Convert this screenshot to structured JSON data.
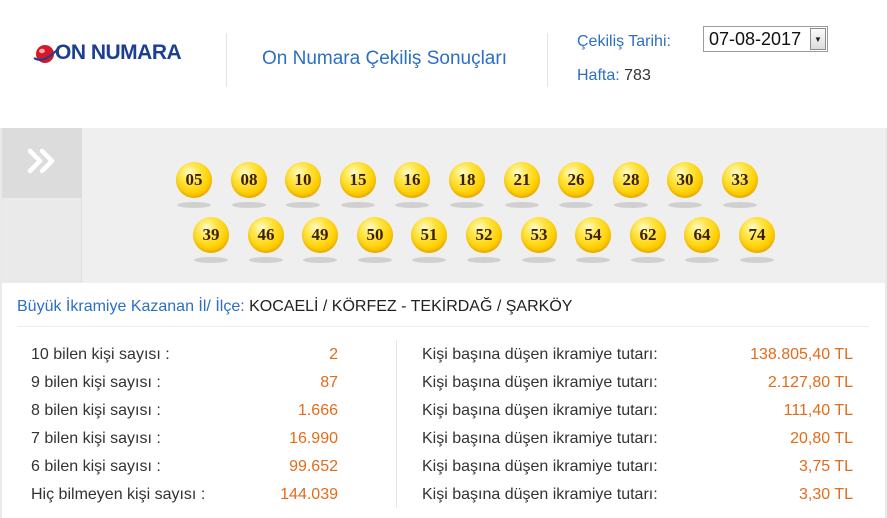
{
  "header": {
    "logo_text": "ON NUMARA",
    "title": "On Numara Çekiliş Sonuçları",
    "date_label": "Çekiliş Tarihi:",
    "date_value": "07-08-2017",
    "week_label": "Hafta:",
    "week_value": "783"
  },
  "nav": {
    "icon": "double-chevron-right-icon"
  },
  "balls": {
    "row1": [
      "05",
      "08",
      "10",
      "15",
      "16",
      "18",
      "21",
      "26",
      "28",
      "30",
      "33"
    ],
    "row2": [
      "39",
      "46",
      "49",
      "50",
      "51",
      "52",
      "53",
      "54",
      "62",
      "64",
      "74"
    ]
  },
  "location": {
    "label": "Büyük İkramiye Kazanan İl/ İlçe:",
    "value": "KOCAELİ / KÖRFEZ - TEKİRDAĞ / ŞARKÖY"
  },
  "results": [
    {
      "label": "10 bilen kişi sayısı :",
      "count": "2",
      "prize_label": "Kişi başına düşen ikramiye tutarı:",
      "amount": "138.805,40 TL"
    },
    {
      "label": "9 bilen kişi sayısı :",
      "count": "87",
      "prize_label": "Kişi başına düşen ikramiye tutarı:",
      "amount": "2.127,80 TL"
    },
    {
      "label": "8 bilen kişi sayısı :",
      "count": "1.666",
      "prize_label": "Kişi başına düşen ikramiye tutarı:",
      "amount": "111,40 TL"
    },
    {
      "label": "7 bilen kişi sayısı :",
      "count": "16.990",
      "prize_label": "Kişi başına düşen ikramiye tutarı:",
      "amount": "20,80 TL"
    },
    {
      "label": "6 bilen kişi sayısı :",
      "count": "99.652",
      "prize_label": "Kişi başına düşen ikramiye tutarı:",
      "amount": "3,75 TL"
    },
    {
      "label": "Hiç bilmeyen kişi sayısı :",
      "count": "144.039",
      "prize_label": "Kişi başına düşen ikramiye tutarı:",
      "amount": "3,30 TL"
    }
  ],
  "colors": {
    "accent_blue": "#2c6fc4",
    "value_orange": "#e36b1a",
    "logo_navy": "#1d3f8f",
    "ball_yellow": "#ffcf00"
  }
}
